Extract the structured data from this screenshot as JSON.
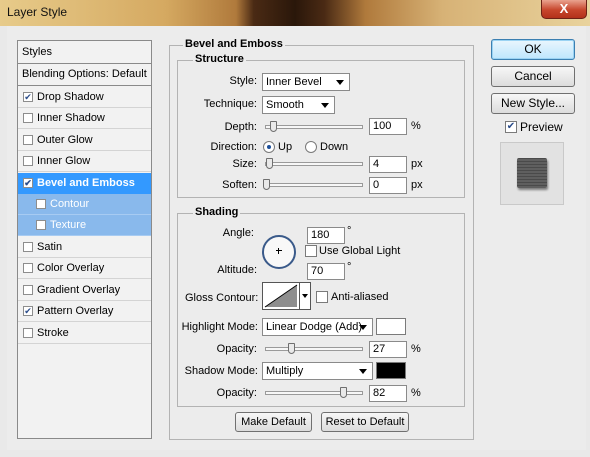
{
  "window": {
    "title": "Layer Style",
    "close": "X"
  },
  "styles_panel": {
    "header": "Styles",
    "blending": "Blending Options: Default",
    "items": [
      {
        "label": "Drop Shadow",
        "checked": true
      },
      {
        "label": "Inner Shadow",
        "checked": false
      },
      {
        "label": "Outer Glow",
        "checked": false
      },
      {
        "label": "Inner Glow",
        "checked": false
      },
      {
        "label": "Bevel and Emboss",
        "checked": true
      },
      {
        "label": "Contour",
        "checked": false
      },
      {
        "label": "Texture",
        "checked": false
      },
      {
        "label": "Satin",
        "checked": false
      },
      {
        "label": "Color Overlay",
        "checked": false
      },
      {
        "label": "Gradient Overlay",
        "checked": false
      },
      {
        "label": "Pattern Overlay",
        "checked": true
      },
      {
        "label": "Stroke",
        "checked": false
      }
    ]
  },
  "bevel": {
    "title": "Bevel and Emboss",
    "structure": {
      "title": "Structure",
      "style_label": "Style:",
      "style_value": "Inner Bevel",
      "technique_label": "Technique:",
      "technique_value": "Smooth",
      "depth_label": "Depth:",
      "depth_value": "100",
      "depth_unit": "%",
      "direction_label": "Direction:",
      "up_label": "Up",
      "down_label": "Down",
      "direction": "Up",
      "size_label": "Size:",
      "size_value": "4",
      "size_unit": "px",
      "soften_label": "Soften:",
      "soften_value": "0",
      "soften_unit": "px"
    },
    "shading": {
      "title": "Shading",
      "angle_label": "Angle:",
      "angle_value": "180",
      "angle_unit": "°",
      "global_light_label": "Use Global Light",
      "global_light": false,
      "altitude_label": "Altitude:",
      "altitude_value": "70",
      "altitude_unit": "°",
      "gloss_label": "Gloss Contour:",
      "anti_aliased_label": "Anti-aliased",
      "anti_aliased": false,
      "highlight_mode_label": "Highlight Mode:",
      "highlight_mode_value": "Linear Dodge (Add)",
      "highlight_color": "#ffffff",
      "highlight_opacity_label": "Opacity:",
      "highlight_opacity_value": "27",
      "highlight_opacity_unit": "%",
      "shadow_mode_label": "Shadow Mode:",
      "shadow_mode_value": "Multiply",
      "shadow_color": "#000000",
      "shadow_opacity_label": "Opacity:",
      "shadow_opacity_value": "82",
      "shadow_opacity_unit": "%"
    },
    "make_default": "Make Default",
    "reset_default": "Reset to Default"
  },
  "actions": {
    "ok": "OK",
    "cancel": "Cancel",
    "new_style": "New Style...",
    "preview_label": "Preview",
    "preview_checked": true
  },
  "colors": {
    "selection": "#3399ff",
    "sub_selection": "#89b9ec"
  }
}
